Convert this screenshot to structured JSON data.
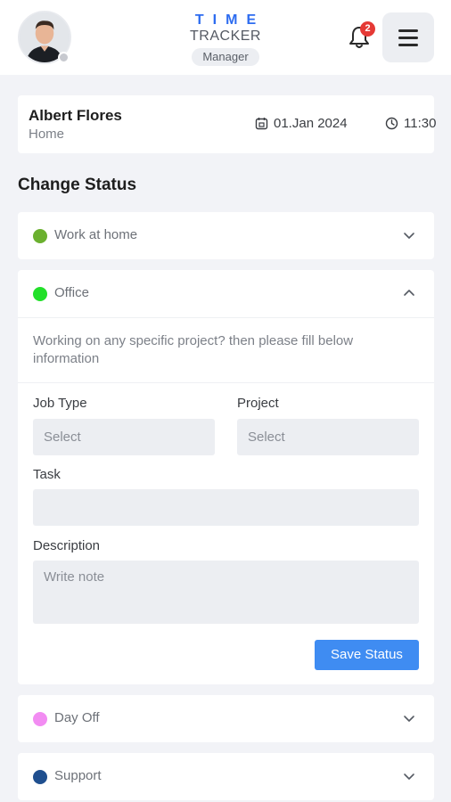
{
  "header": {
    "logo_time": "TIME",
    "logo_tracker": "TRACKER",
    "role_badge": "Manager",
    "notification_count": "2"
  },
  "user": {
    "name": "Albert Flores",
    "location": "Home",
    "date": "01.Jan 2024",
    "time": "11:30"
  },
  "section_title": "Change Status",
  "statuses": [
    {
      "label": "Work at home",
      "color": "#6bb02f",
      "expanded": false
    },
    {
      "label": "Office",
      "color": "#22e02a",
      "expanded": true
    },
    {
      "label": "Day Off",
      "color": "#f28cf2",
      "expanded": false
    },
    {
      "label": "Support",
      "color": "#1f4f8f",
      "expanded": false
    }
  ],
  "office_form": {
    "prompt": "Working on any specific project? then please fill below information",
    "job_type_label": "Job Type",
    "job_type_value": "Select",
    "project_label": "Project",
    "project_value": "Select",
    "task_label": "Task",
    "task_value": "",
    "description_label": "Description",
    "description_placeholder": "Write note",
    "save_label": "Save Status"
  },
  "colors": {
    "accent": "#3f8cf2",
    "logo_blue": "#2d6cf0",
    "badge_red": "#e53935"
  }
}
